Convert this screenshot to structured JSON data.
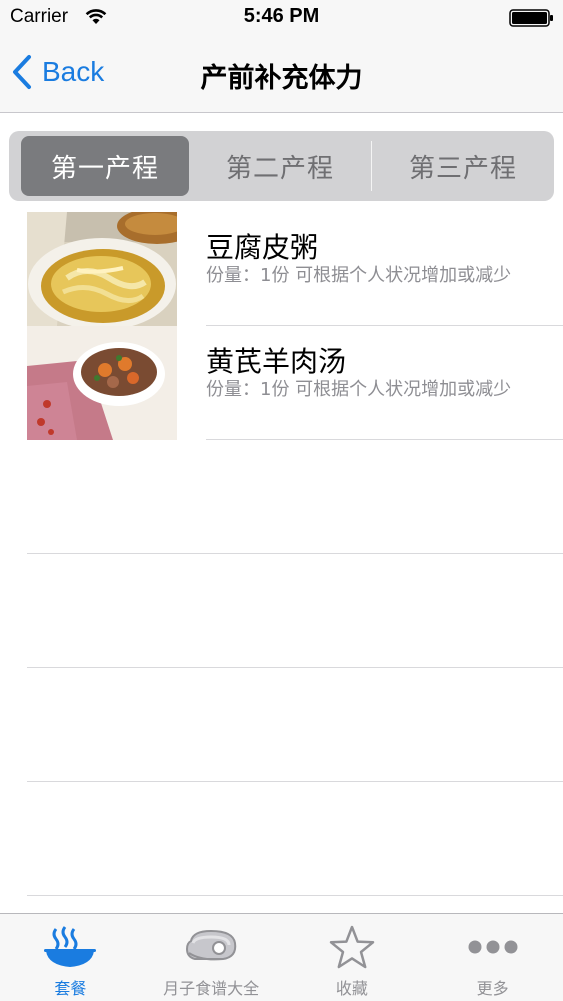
{
  "status_bar": {
    "carrier": "Carrier",
    "time": "5:46 PM"
  },
  "nav": {
    "back_label": "Back",
    "title": "产前补充体力"
  },
  "segments": [
    {
      "label": "第一产程",
      "selected": true
    },
    {
      "label": "第二产程",
      "selected": false
    },
    {
      "label": "第三产程",
      "selected": false
    }
  ],
  "recipes": [
    {
      "title": "豆腐皮粥",
      "description": "份量：1份 可根据个人状况增加或减少",
      "image": "tofu-skin-porridge-photo"
    },
    {
      "title": "黄芪羊肉汤",
      "description": "份量：1份 可根据个人状况增加或减少",
      "image": "astragalus-mutton-soup-photo"
    }
  ],
  "tabs": [
    {
      "label": "套餐",
      "icon": "steaming-bowl-icon",
      "active": true
    },
    {
      "label": "月子食谱大全",
      "icon": "meat-icon",
      "active": false
    },
    {
      "label": "收藏",
      "icon": "star-icon",
      "active": false
    },
    {
      "label": "更多",
      "icon": "more-dots-icon",
      "active": false
    }
  ],
  "colors": {
    "accent": "#1a7ce0",
    "segment_active": "#7a7b7e",
    "inactive_tab": "#929296",
    "secondary_text": "#8e8e93"
  }
}
